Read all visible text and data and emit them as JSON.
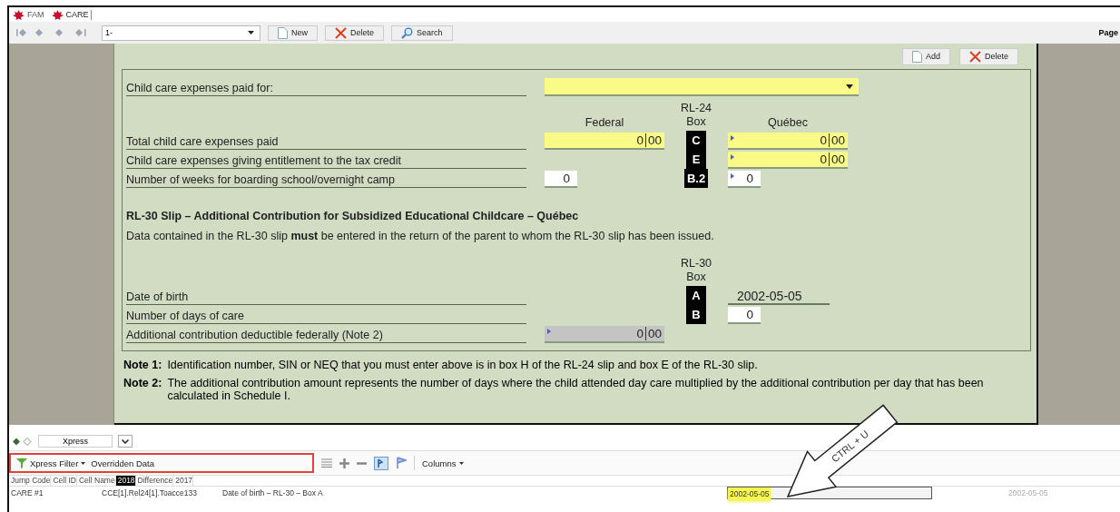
{
  "tabs": [
    {
      "label": "FAM",
      "selected": false
    },
    {
      "label": "CARE",
      "selected": true
    }
  ],
  "toolbar": {
    "record": "1-",
    "buttons": [
      "New",
      "Delete",
      "Search"
    ],
    "page_label": "Page"
  },
  "form_buttons": [
    "Add",
    "Delete"
  ],
  "form": {
    "paid_for_label": "Child care expenses paid for:",
    "rl24_header": {
      "federal": "Federal",
      "box_top": "RL-24",
      "box_bottom": "Box",
      "quebec": "Québec"
    },
    "rl24_rows": [
      {
        "label": "Total child care expenses paid",
        "box": "C",
        "federal": {
          "kind": "money",
          "required": true,
          "disabled": false,
          "marker": false,
          "dollars": "0",
          "cents": "00"
        },
        "quebec": {
          "kind": "money",
          "required": true,
          "disabled": false,
          "marker": true,
          "dollars": "0",
          "cents": "00"
        }
      },
      {
        "label": "Child care expenses giving entitlement to the tax credit",
        "box": "E",
        "quebec": {
          "kind": "money",
          "required": true,
          "disabled": false,
          "marker": true,
          "dollars": "0",
          "cents": "00"
        }
      },
      {
        "label": "Number of weeks for boarding school/overnight camp",
        "box": "B.2",
        "federal": {
          "kind": "number",
          "required": false,
          "disabled": false,
          "marker": false,
          "value": "0"
        },
        "quebec": {
          "kind": "number",
          "required": false,
          "disabled": false,
          "marker": true,
          "value": "0"
        }
      }
    ],
    "rl30_title": "RL-30 Slip – Additional Contribution for Subsidized Educational Childcare – Québec",
    "rl30_text": "Data contained in the RL-30 slip **must** be entered in the return of the parent to whom the RL-30 slip has been issued.",
    "rl30_header": {
      "box_top": "RL-30",
      "box_bottom": "Box"
    },
    "rl30_rows": [
      {
        "label": "Date of birth",
        "box": "A",
        "quebec": {
          "kind": "date",
          "marker": false,
          "value": "2002-05-05"
        }
      },
      {
        "label": "Number of days of care",
        "box": "B",
        "quebec": {
          "kind": "number",
          "required": false,
          "disabled": false,
          "marker": false,
          "value": "0"
        }
      },
      {
        "label": "Additional contribution deductible federally (Note 2)",
        "federal": {
          "kind": "money",
          "disabled": true,
          "marker": true,
          "dollars": "0",
          "cents": "00"
        }
      }
    ]
  },
  "notes": [
    {
      "label": "Note 1:",
      "text": "Identification number, SIN or NEQ that you must enter above is in box H of the RL-24 slip and box E of the RL-30 slip."
    },
    {
      "label": "Note 2:",
      "text": "The additional contribution amount represents the number of days where the child attended day care multiplied by the additional contribution per day that has been calculated in Schedule I."
    }
  ],
  "xpress": {
    "view": "Xpress",
    "filter_button": "Xpress Filter",
    "filter_value": "Overridden Data",
    "columns_button": "Columns"
  },
  "table": {
    "columns": [
      {
        "label": "Jump Code",
        "selected": false
      },
      {
        "label": "Cell ID",
        "selected": false
      },
      {
        "label": "Cell Name",
        "selected": false
      },
      {
        "label": "2018",
        "selected": true
      },
      {
        "label": "Difference",
        "selected": false
      },
      {
        "label": "2017",
        "selected": false
      }
    ],
    "rows": [
      {
        "jump_code": "CARE #1",
        "cell_id": "CCE[1].Rel24[1].Toacce133",
        "cell_name": "Date of birth – RL-30 – Box A",
        "current": "2002-05-05",
        "previous": "2002-05-05",
        "highlighted": true
      }
    ]
  },
  "callout": {
    "text": "CTRL + U"
  }
}
